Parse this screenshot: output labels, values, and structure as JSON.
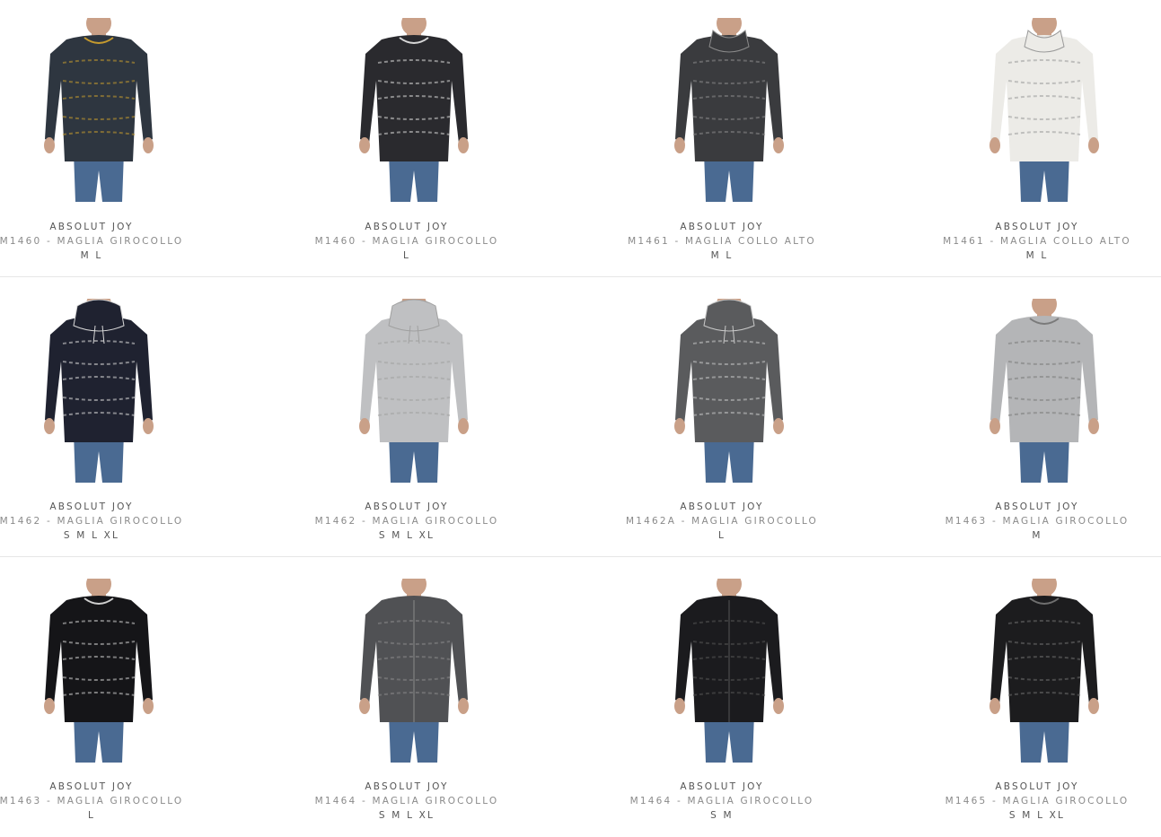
{
  "products": [
    {
      "brand": "ABSOLUT JOY",
      "name": "M1460 - MAGLIA GIROCOLLO",
      "sizes": "M L",
      "sweater": "#2e3640",
      "accent": "#c59a2e",
      "neck": "crew"
    },
    {
      "brand": "ABSOLUT JOY",
      "name": "M1460 - MAGLIA GIROCOLLO",
      "sizes": "L",
      "sweater": "#2a2a2e",
      "accent": "#d8d8d8",
      "neck": "crew"
    },
    {
      "brand": "ABSOLUT JOY",
      "name": "M1461 - MAGLIA COLLO ALTO",
      "sizes": "M L",
      "sweater": "#3a3b3e",
      "accent": "#8a8a8a",
      "neck": "high"
    },
    {
      "brand": "ABSOLUT JOY",
      "name": "M1461 - MAGLIA COLLO ALTO",
      "sizes": "M L",
      "sweater": "#ecebe7",
      "accent": "#9a9a9a",
      "neck": "high"
    },
    {
      "brand": "ABSOLUT JOY",
      "name": "M1462 - MAGLIA GIROCOLLO",
      "sizes": "S M L XL",
      "sweater": "#1f2230",
      "accent": "#d8d8d8",
      "neck": "hood"
    },
    {
      "brand": "ABSOLUT JOY",
      "name": "M1462 - MAGLIA GIROCOLLO",
      "sizes": "S M L XL",
      "sweater": "#bfc0c2",
      "accent": "#a0a0a0",
      "neck": "hood"
    },
    {
      "brand": "ABSOLUT JOY",
      "name": "M1462A - MAGLIA GIROCOLLO",
      "sizes": "L",
      "sweater": "#5a5b5d",
      "accent": "#c8c8c8",
      "neck": "hood"
    },
    {
      "brand": "ABSOLUT JOY",
      "name": "M1463 - MAGLIA GIROCOLLO",
      "sizes": "M",
      "sweater": "#b4b5b7",
      "accent": "#7a7a7a",
      "neck": "crew"
    },
    {
      "brand": "ABSOLUT JOY",
      "name": "M1463 - MAGLIA GIROCOLLO",
      "sizes": "L",
      "sweater": "#151518",
      "accent": "#cfcfcf",
      "neck": "crew"
    },
    {
      "brand": "ABSOLUT JOY",
      "name": "M1464 - MAGLIA GIROCOLLO",
      "sizes": "S M L XL",
      "sweater": "#505154",
      "accent": "#8a8a8a",
      "neck": "cardigan"
    },
    {
      "brand": "ABSOLUT JOY",
      "name": "M1464 - MAGLIA GIROCOLLO",
      "sizes": "S M",
      "sweater": "#1b1b1e",
      "accent": "#555555",
      "neck": "cardigan"
    },
    {
      "brand": "ABSOLUT JOY",
      "name": "M1465 - MAGLIA GIROCOLLO",
      "sizes": "S M L XL",
      "sweater": "#1c1c1e",
      "accent": "#6f6f6f",
      "neck": "crew"
    }
  ],
  "colors": {
    "skin": "#c9a088",
    "jeans": "#4a6a92",
    "background": "#ffffff"
  }
}
